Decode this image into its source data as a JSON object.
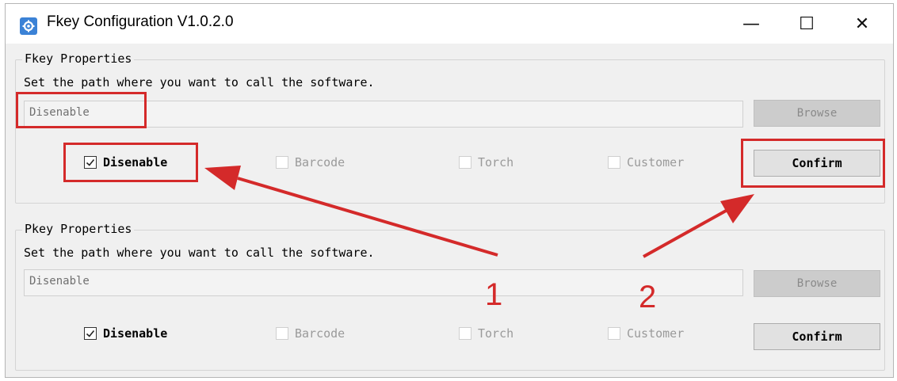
{
  "window": {
    "title": "Fkey Configuration V1.0.2.0",
    "minimize_glyph": "—",
    "maximize_glyph": "☐",
    "close_glyph": "✕"
  },
  "fkey": {
    "group_title": "Fkey Properties",
    "description": "Set the path where you want to call the software.",
    "path_value": "Disenable",
    "browse_label": "Browse",
    "options": [
      {
        "label": "Disenable",
        "checked": true,
        "enabled": true
      },
      {
        "label": "Barcode",
        "checked": false,
        "enabled": false
      },
      {
        "label": "Torch",
        "checked": false,
        "enabled": false
      },
      {
        "label": "Customer",
        "checked": false,
        "enabled": false
      }
    ],
    "confirm_label": "Confirm"
  },
  "pkey": {
    "group_title": "Pkey Properties",
    "description": "Set the path where you want to call the software.",
    "path_value": "Disenable",
    "browse_label": "Browse",
    "options": [
      {
        "label": "Disenable",
        "checked": true,
        "enabled": true
      },
      {
        "label": "Barcode",
        "checked": false,
        "enabled": false
      },
      {
        "label": "Torch",
        "checked": false,
        "enabled": false
      },
      {
        "label": "Customer",
        "checked": false,
        "enabled": false
      }
    ],
    "confirm_label": "Confirm"
  },
  "annotations": {
    "step1": "1",
    "step2": "2",
    "color": "#d42a2a"
  },
  "icons": {
    "app": "gear-icon",
    "checkbox": "checkmark-icon"
  }
}
